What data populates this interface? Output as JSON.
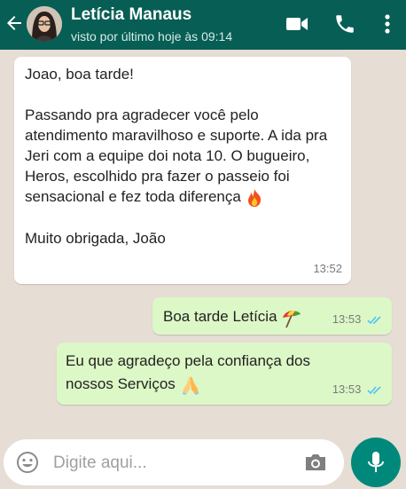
{
  "header": {
    "contact_name": "Letícia Manaus",
    "last_seen": "visto por último hoje às 09:14",
    "icons": [
      "back-arrow-icon",
      "video-call-icon",
      "phone-icon",
      "more-options-icon"
    ]
  },
  "messages": [
    {
      "direction": "incoming",
      "text": "Joao, boa tarde!\n\nPassando pra agradecer você pelo atendimento maravilhoso e suporte. A ida pra Jeri com a equipe doi nota 10. O bugueiro, Heros, escolhido pra fazer o passeio foi sensacional e fez toda diferença",
      "emoji": "fire-emoji",
      "signoff": "Muito obrigada, João",
      "time": "13:52"
    },
    {
      "direction": "outgoing",
      "text": "Boa tarde Letícia",
      "emoji": "beach-umbrella-emoji",
      "time": "13:53",
      "status": "read"
    },
    {
      "direction": "outgoing",
      "text": "Eu que agradeço pela confiança dos nossos Serviços",
      "emoji": "praying-hands-emoji",
      "time": "13:53",
      "status": "read"
    }
  ],
  "composer": {
    "placeholder": "Digite aqui...",
    "icons": [
      "emoji-icon",
      "camera-icon",
      "mic-icon"
    ]
  },
  "colors": {
    "header": "#075e54",
    "chat_background": "#e6ddd4",
    "incoming_bubble": "#ffffff",
    "outgoing_bubble": "#dcf8c6",
    "read_ticks": "#4fc3f7",
    "mic_button": "#00897b"
  }
}
